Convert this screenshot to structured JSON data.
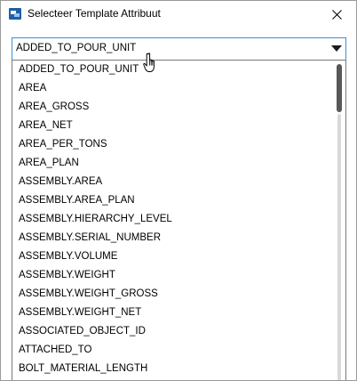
{
  "window": {
    "title": "Selecteer Template Attribuut",
    "close_label": "close"
  },
  "combo": {
    "selected_value": "ADDED_TO_POUR_UNIT"
  },
  "dropdown": {
    "items": [
      {
        "label": "ADDED_TO_POUR_UNIT"
      },
      {
        "label": "AREA"
      },
      {
        "label": "AREA_GROSS"
      },
      {
        "label": "AREA_NET"
      },
      {
        "label": "AREA_PER_TONS"
      },
      {
        "label": "AREA_PLAN"
      },
      {
        "label": "ASSEMBLY.AREA"
      },
      {
        "label": "ASSEMBLY.AREA_PLAN"
      },
      {
        "label": "ASSEMBLY.HIERARCHY_LEVEL"
      },
      {
        "label": "ASSEMBLY.SERIAL_NUMBER"
      },
      {
        "label": "ASSEMBLY.VOLUME"
      },
      {
        "label": "ASSEMBLY.WEIGHT"
      },
      {
        "label": "ASSEMBLY.WEIGHT_GROSS"
      },
      {
        "label": "ASSEMBLY.WEIGHT_NET"
      },
      {
        "label": "ASSOCIATED_OBJECT_ID"
      },
      {
        "label": "ATTACHED_TO"
      },
      {
        "label": "BOLT_MATERIAL_LENGTH"
      }
    ]
  },
  "icons": {
    "app": "app-icon",
    "close": "close-icon",
    "dropdown_arrow": "triangle-down-icon",
    "cursor": "hand-pointer-icon"
  },
  "colors": {
    "accent_border": "#3a8fd8",
    "scroll_thumb": "#585858",
    "app_icon": "#1e5ea8"
  }
}
